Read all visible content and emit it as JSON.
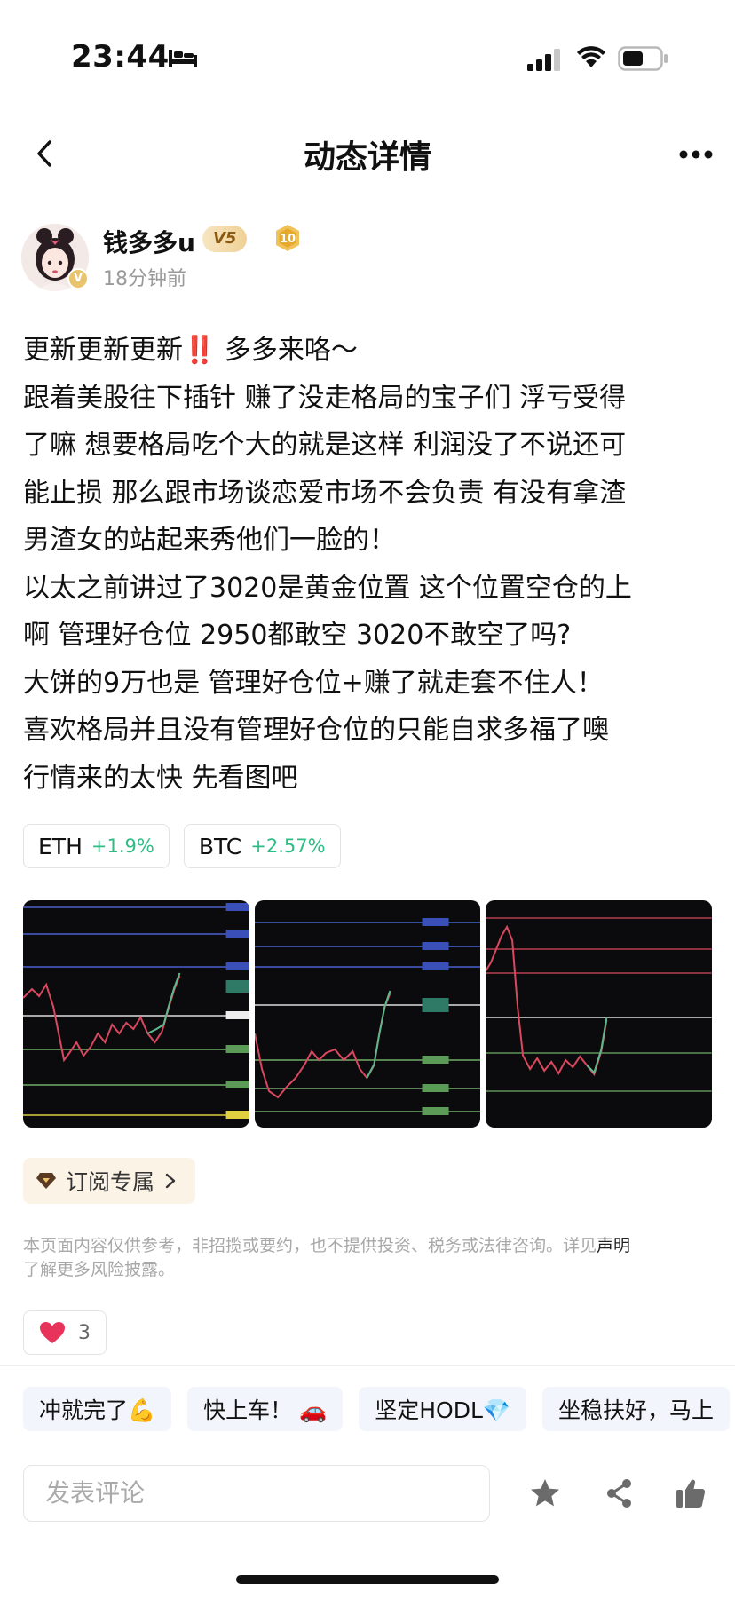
{
  "status_bar": {
    "time": "23:44"
  },
  "nav": {
    "title": "动态详情"
  },
  "author": {
    "name": "钱多多u",
    "vip_badge": "V5",
    "level": "10",
    "avatar_badge": "V",
    "time_ago": "18分钟前"
  },
  "post": {
    "lines": [
      {
        "pre": "更新更新更新",
        "mark": "‼️",
        "post": " 多多来咯～"
      },
      {
        "text": "跟着美股往下插针 赚了没走格局的宝子们 浮亏受得"
      },
      {
        "text": "了嘛 想要格局吃个大的就是这样 利润没了不说还可"
      },
      {
        "text": "能止损 那么跟市场谈恋爱市场不会负责 有没有拿渣"
      },
      {
        "text": "男渣女的站起来秀他们一脸的！"
      },
      {
        "text": "以太之前讲过了3020是黄金位置 这个位置空仓的上"
      },
      {
        "text": "啊 管理好仓位 2950都敢空 3020不敢空了吗?"
      },
      {
        "text": "大饼的9万也是 管理好仓位+赚了就走套不住人！"
      },
      {
        "text": "喜欢格局并且没有管理好仓位的只能自求多福了噢"
      },
      {
        "text": "行情来的太快 先看图吧"
      }
    ]
  },
  "tickers": [
    {
      "symbol": "ETH",
      "change": "+1.9%"
    },
    {
      "symbol": "BTC",
      "change": "+2.57%"
    }
  ],
  "subscribe": {
    "label": "订阅专属"
  },
  "disclaimer": {
    "text": "本页面内容仅供参考，非招揽或要约，也不提供投资、税务或法律咨询。详见",
    "link": "声明",
    "text2": "了解更多风险披露。"
  },
  "like": {
    "count": "3"
  },
  "quick_replies": [
    "冲就完了💪",
    "快上车！ 🚗",
    "坚定HODL💎",
    "坐稳扶好，马上"
  ],
  "comment": {
    "placeholder": "发表评论"
  },
  "colors": {
    "up": "#2ebd85",
    "accent": "#e0262f",
    "badge_gold": "#efd196"
  }
}
